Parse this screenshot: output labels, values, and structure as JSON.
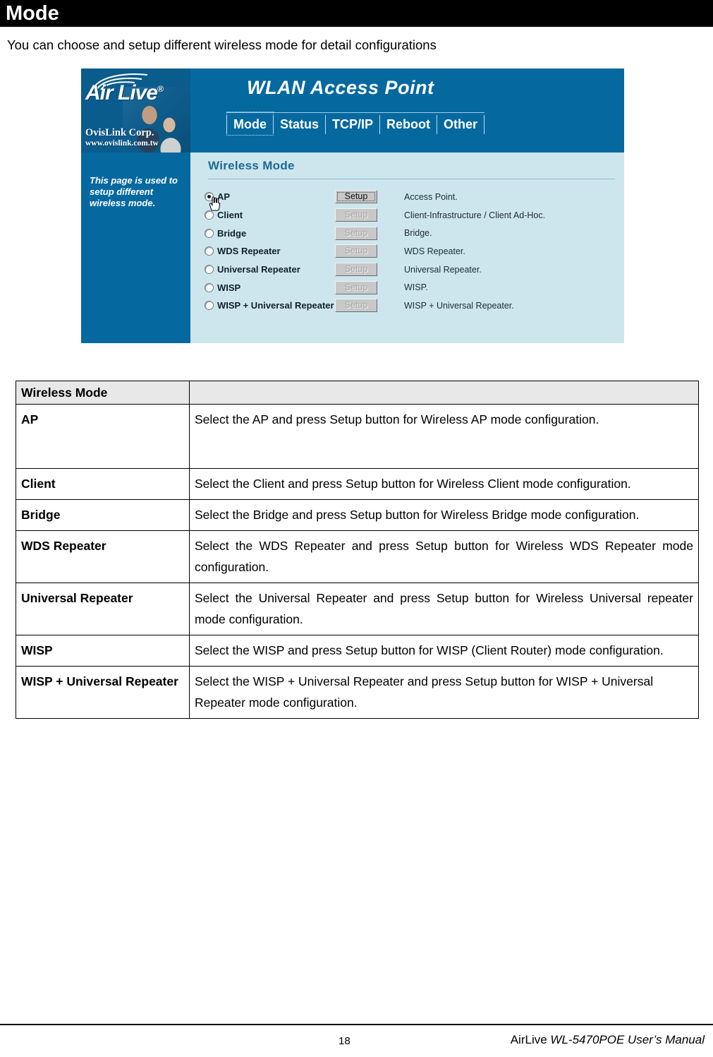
{
  "page": {
    "heading": "Mode",
    "intro": "You can choose and setup different wireless mode for detail configurations"
  },
  "screenshot": {
    "brand": {
      "logo_word": "Air Live",
      "registered_mark": "®",
      "company": "OvisLink Corp.",
      "website": "www.ovislink.com.tw"
    },
    "device_title": "WLAN Access Point",
    "tabs": [
      {
        "label": "Mode",
        "active": true
      },
      {
        "label": "Status",
        "active": false
      },
      {
        "label": "TCP/IP",
        "active": false
      },
      {
        "label": "Reboot",
        "active": false
      },
      {
        "label": "Other",
        "active": false
      }
    ],
    "sidebar_note": "This page is used to setup different wireless mode.",
    "panel_heading": "Wireless Mode",
    "setup_button_label": "Setup",
    "modes": [
      {
        "label": "AP",
        "selected": true,
        "setup_enabled": true,
        "description": "Access Point."
      },
      {
        "label": "Client",
        "selected": false,
        "setup_enabled": false,
        "description": "Client-Infrastructure / Client Ad-Hoc."
      },
      {
        "label": "Bridge",
        "selected": false,
        "setup_enabled": false,
        "description": "Bridge."
      },
      {
        "label": "WDS Repeater",
        "selected": false,
        "setup_enabled": false,
        "description": "WDS Repeater."
      },
      {
        "label": "Universal Repeater",
        "selected": false,
        "setup_enabled": false,
        "description": "Universal Repeater."
      },
      {
        "label": "WISP",
        "selected": false,
        "setup_enabled": false,
        "description": "WISP."
      },
      {
        "label": "WISP + Universal Repeater",
        "selected": false,
        "setup_enabled": false,
        "description": "WISP + Universal Repeater."
      }
    ],
    "colors": {
      "header_blue": "#0569A0",
      "panel_blue": "#CDE6EE",
      "heading_text": "#1b6a93"
    }
  },
  "table": {
    "headers": [
      "Wireless Mode",
      ""
    ],
    "rows": [
      {
        "term": "AP",
        "definition": "Select the AP and press Setup button for Wireless AP mode configuration."
      },
      {
        "term": "Client",
        "definition": "Select the Client and press Setup button for Wireless Client mode configuration."
      },
      {
        "term": "Bridge",
        "definition": "Select the Bridge and press Setup button for Wireless Bridge mode configuration."
      },
      {
        "term": "WDS Repeater",
        "definition": "Select the WDS Repeater and press Setup button for Wireless WDS Repeater mode configuration."
      },
      {
        "term": "Universal Repeater",
        "definition": "Select the Universal Repeater and press Setup button for Wireless Universal repeater mode configuration."
      },
      {
        "term": "WISP",
        "definition": "Select the WISP and press Setup button for WISP (Client Router) mode configuration."
      },
      {
        "term": "WISP + Universal Repeater",
        "definition": "Select the WISP + Universal Repeater and press Setup button for WISP + Universal Repeater mode configuration."
      }
    ]
  },
  "footer": {
    "page_number": "18",
    "manual_brand": "AirLive",
    "manual_title": "WL-5470POE User’s Manual"
  }
}
